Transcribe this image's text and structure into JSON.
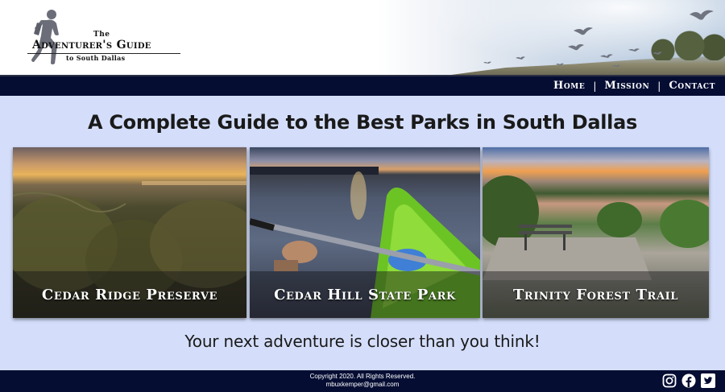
{
  "logo": {
    "the": "The",
    "title": "Adventurer's Guide",
    "subtitle": "to South Dallas"
  },
  "nav": {
    "items": [
      "Home",
      "Mission",
      "Contact"
    ],
    "separator": "|"
  },
  "headline": "A Complete Guide to the Best Parks in South Dallas",
  "cards": [
    {
      "label": "Cedar Ridge Preserve"
    },
    {
      "label": "Cedar Hill State Park"
    },
    {
      "label": "Trinity Forest Trail"
    }
  ],
  "tagline": "Your next adventure is closer than you think!",
  "footer": {
    "copyright": "Copyright 2020. All Rights Reserved.",
    "email": "mbuxkemper@gmail.com",
    "social": [
      "instagram-icon",
      "facebook-icon",
      "twitter-icon"
    ]
  },
  "colors": {
    "navy": "#050d33",
    "page_bg": "#d4defa"
  }
}
